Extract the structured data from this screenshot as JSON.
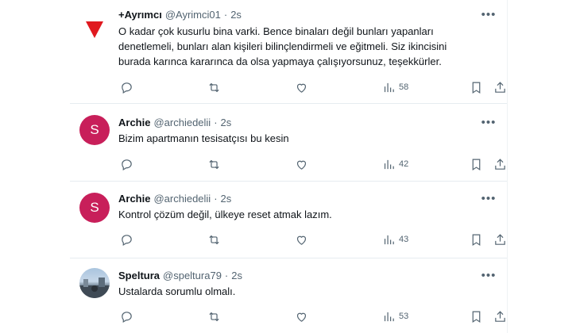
{
  "tweets": [
    {
      "name": "+Ayrımcı",
      "handle": "@Ayrimci01",
      "dot": "·",
      "time": "2s",
      "more": "•••",
      "avatar_type": "triangle",
      "avatar_color": "#e0191f",
      "text": "O kadar çok kusurlu bina varki. Bence binaları değil bunları yapanları\ndenetlemeli, bunları alan kişileri bilinçlendirmeli ve eğitmeli. Siz ikincisini\nburada karınca kararınca da olsa yapmaya çalışıyorsunuz, teşekkürler.",
      "views": "58"
    },
    {
      "name": "Archie",
      "handle": "@archiedelii",
      "dot": "·",
      "time": "2s",
      "more": "•••",
      "avatar_type": "letter",
      "avatar_letter": "S",
      "text": "Bizim apartmanın tesisatçısı bu kesin",
      "views": "42"
    },
    {
      "name": "Archie",
      "handle": "@archiedelii",
      "dot": "·",
      "time": "2s",
      "more": "•••",
      "avatar_type": "letter",
      "avatar_letter": "S",
      "text": "Kontrol çözüm değil, ülkeye reset atmak lazım.",
      "views": "43"
    },
    {
      "name": "Speltura",
      "handle": "@speltura79",
      "dot": "·",
      "time": "2s",
      "more": "•••",
      "avatar_type": "photo",
      "text": "Ustalarda sorumlu olmalı.",
      "views": "53"
    }
  ],
  "colors": {
    "letter_avatar": "#c81f5a",
    "text_primary": "#0f1419",
    "text_secondary": "#536471",
    "divider": "#e6ecf0"
  }
}
